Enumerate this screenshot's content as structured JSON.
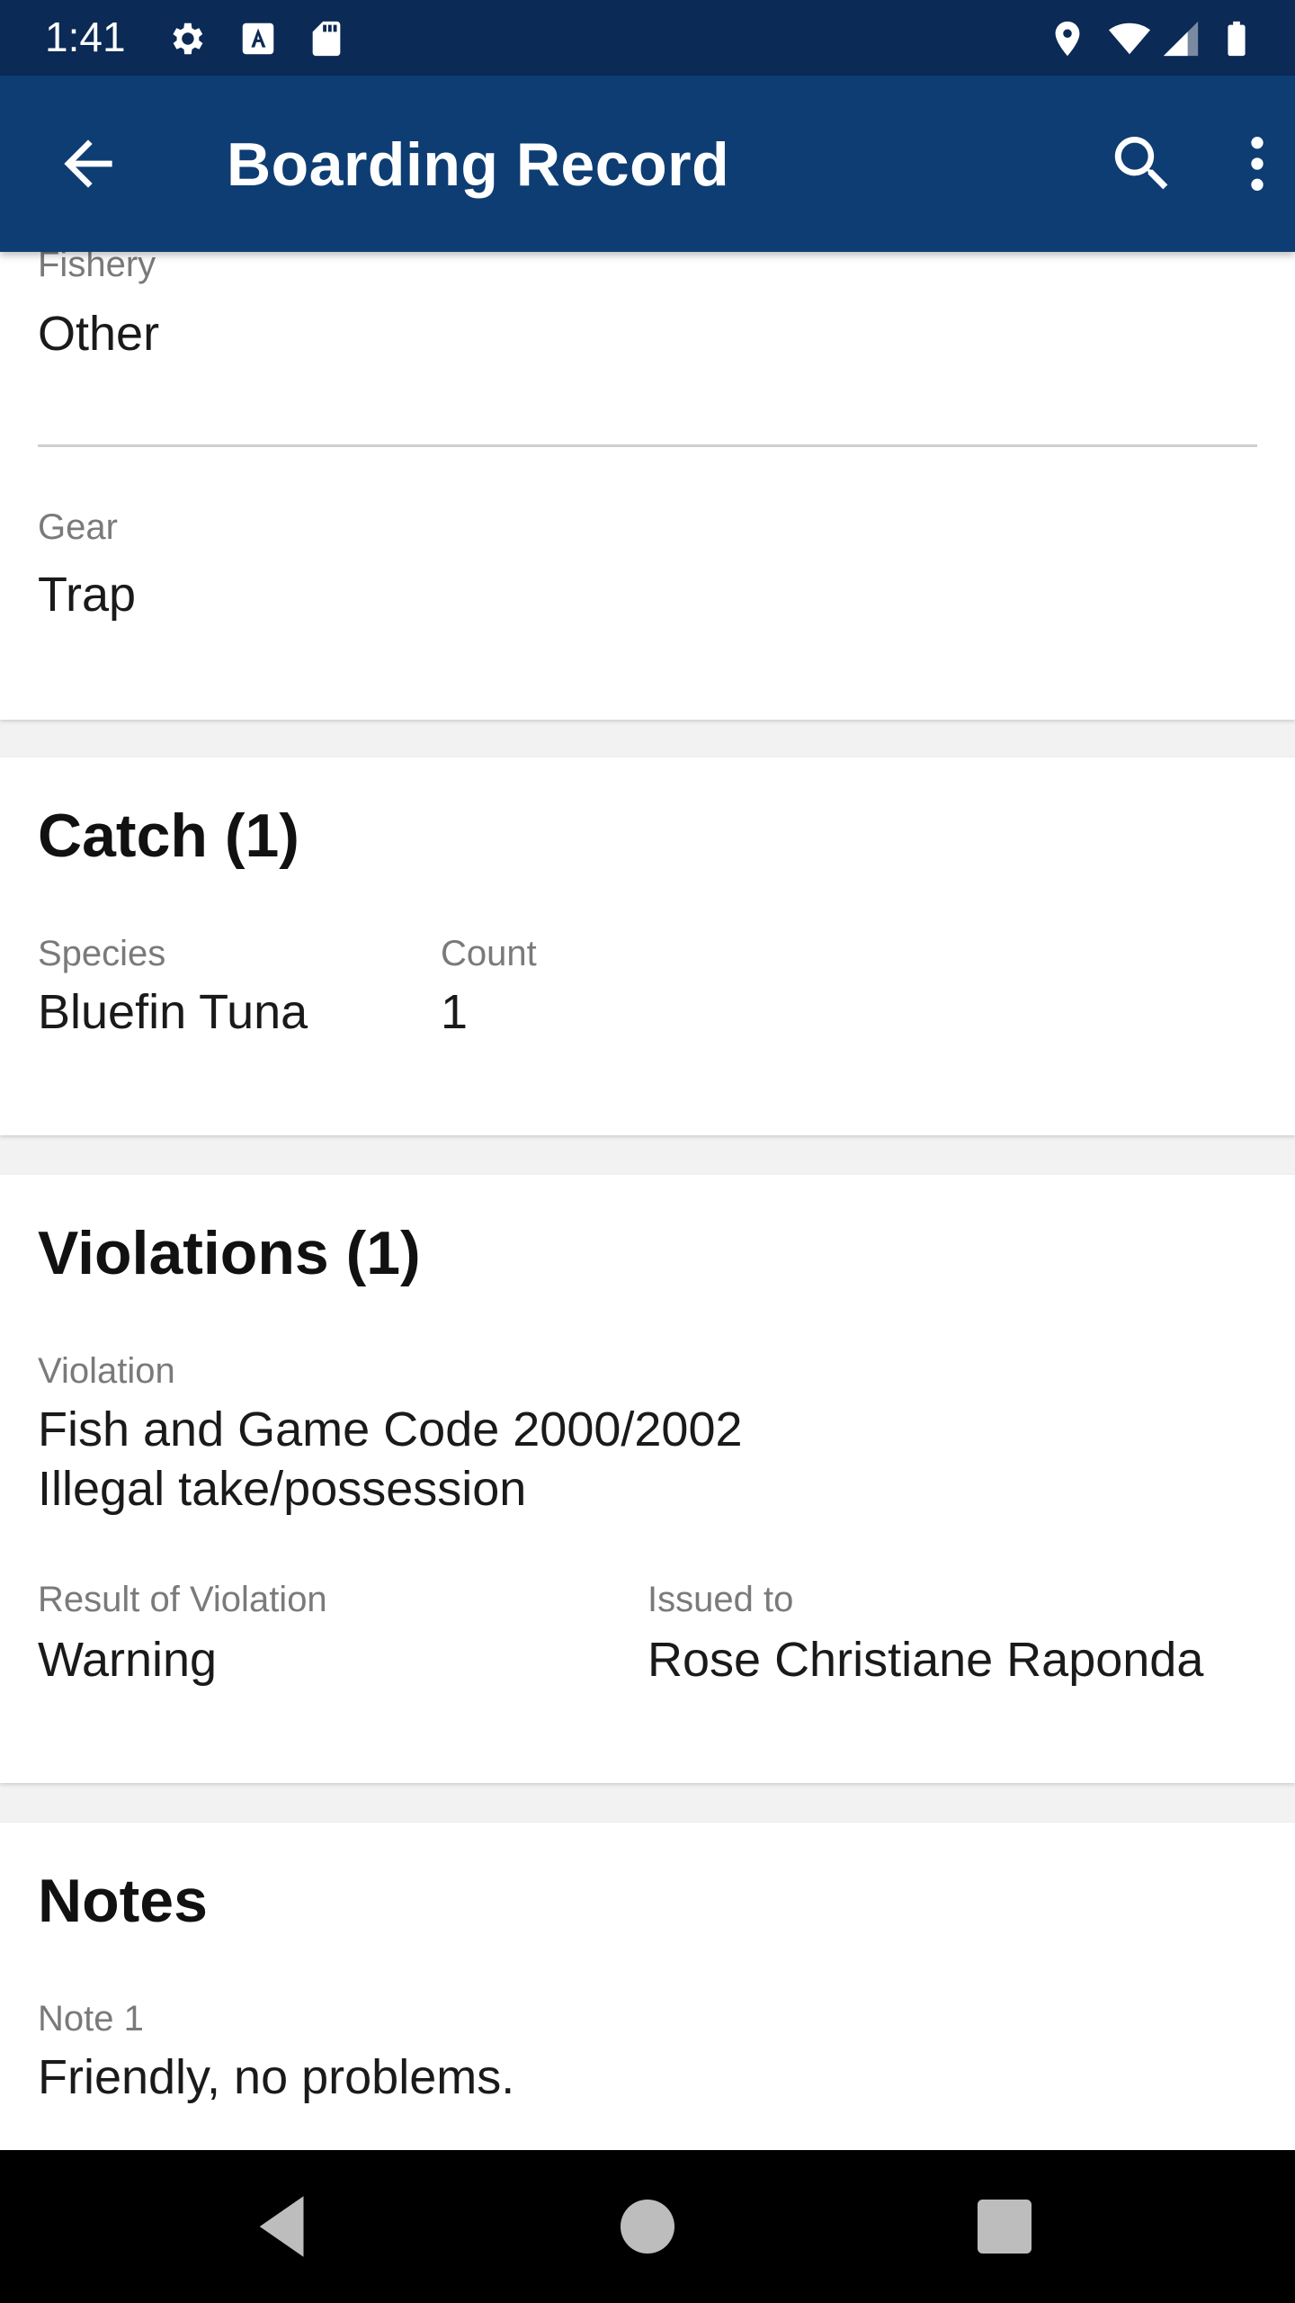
{
  "status_bar": {
    "time": "1:41",
    "left_icons": [
      "gear-icon",
      "font-a-icon",
      "sd-card-icon"
    ],
    "right_icons": [
      "location-icon",
      "wifi-icon",
      "signal-icon",
      "battery-icon"
    ]
  },
  "app_bar": {
    "title": "Boarding Record",
    "back_icon": "arrow-left-icon",
    "search_icon": "search-icon",
    "menu_icon": "more-vert-icon",
    "color": "#0d3d73"
  },
  "general": {
    "fishery_label": "Fishery",
    "fishery_value": "Other",
    "gear_label": "Gear",
    "gear_value": "Trap"
  },
  "catch": {
    "title": "Catch (1)",
    "species_label": "Species",
    "species_value": "Bluefin Tuna",
    "count_label": "Count",
    "count_value": "1"
  },
  "violations": {
    "title": "Violations (1)",
    "violation_label": "Violation",
    "violation_line1": "Fish and Game Code 2000/2002",
    "violation_line2": "Illegal take/possession",
    "result_label": "Result of Violation",
    "result_value": "Warning",
    "issued_label": "Issued to",
    "issued_value": "Rose Christiane Raponda"
  },
  "notes": {
    "title": "Notes",
    "note_label": "Note 1",
    "note_value": "Friendly, no problems."
  },
  "nav_bar": {
    "icons": [
      "back-triangle-icon",
      "home-circle-icon",
      "recents-square-icon"
    ]
  }
}
